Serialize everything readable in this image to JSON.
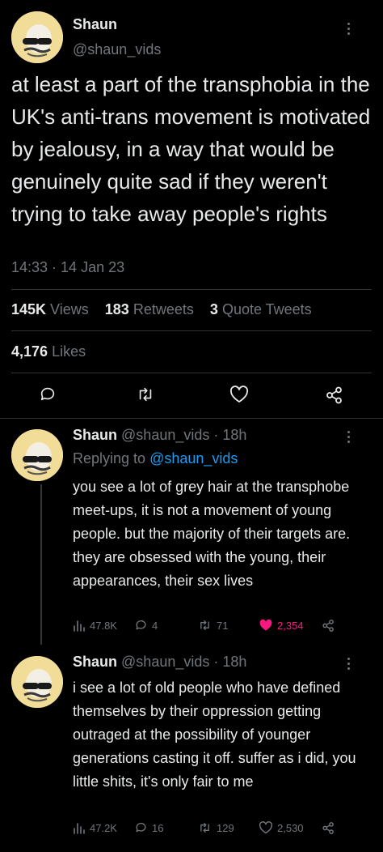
{
  "main_tweet": {
    "author_name": "Shaun",
    "author_handle": "@shaun_vids",
    "text": "at least a part of the transphobia in the UK's anti-trans movement is motivated by jealousy, in a way that would be genuinely quite sad if they weren't trying to take away people's rights",
    "timestamp": "14:33 · 14 Jan 23",
    "views_count": "145K",
    "views_label": "Views",
    "retweets_count": "183",
    "retweets_label": "Retweets",
    "quotes_count": "3",
    "quotes_label": "Quote Tweets",
    "likes_count": "4,176",
    "likes_label": "Likes"
  },
  "replies": [
    {
      "author_name": "Shaun",
      "author_handle": "@shaun_vids",
      "time": "· 18h",
      "replying_prefix": "Replying to",
      "replying_to": "@shaun_vids",
      "text": "you see a lot of grey hair at the transphobe meet-ups, it is not a movement of young people. but the majority of their targets are. they are obsessed with the young, their appearances, their sex lives",
      "views": "47.8K",
      "replies": "4",
      "retweets": "71",
      "likes": "2,354",
      "liked": true
    },
    {
      "author_name": "Shaun",
      "author_handle": "@shaun_vids",
      "time": "· 18h",
      "text": "i see a lot of old people who have defined themselves by their oppression getting outraged at the possibility of younger generations casting it off. suffer as i did, you little shits, it's only fair to me",
      "views": "47.2K",
      "replies": "16",
      "retweets": "129",
      "likes": "2,530",
      "liked": false
    }
  ],
  "colors": {
    "background": "#000000",
    "text": "#e7e9ea",
    "muted": "#71767b",
    "link": "#1d9bf0",
    "like_active": "#f91880",
    "divider": "#2f3336"
  }
}
